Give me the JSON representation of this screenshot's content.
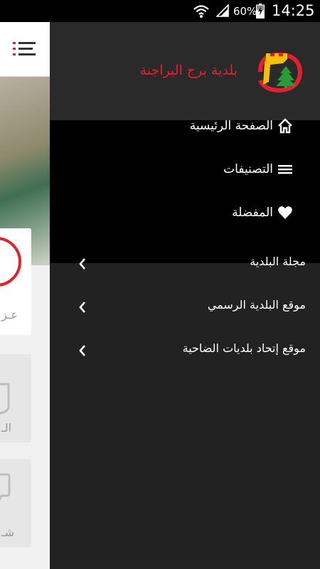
{
  "status_bar": {
    "battery_percent": "60%",
    "time": "14:25",
    "icons": [
      "wifi-icon",
      "signal-icon",
      "battery-charging-icon"
    ]
  },
  "background_page": {
    "card_text_1": "عـز",
    "card_text_2": "الـ",
    "card_text_3": "شـ"
  },
  "drawer": {
    "brand_name": "بلدية برج البراجنة",
    "primary_menu": [
      {
        "label": "الصفحة الرئيسية",
        "icon": "home-icon"
      },
      {
        "label": "التصنيفات",
        "icon": "list-icon"
      },
      {
        "label": "المفضلة",
        "icon": "heart-icon"
      }
    ],
    "links": [
      {
        "label": "مجلة البلدية",
        "icon": "chevron-left-icon"
      },
      {
        "label": "موقع البلدية الرسمي",
        "icon": "chevron-left-icon"
      },
      {
        "label": "موقع إتحاد بلديات الضاحية",
        "icon": "chevron-left-icon"
      }
    ]
  },
  "colors": {
    "accent_red": "#e5202e",
    "drawer_bg": "#222222",
    "header_bg": "#2a2a2a",
    "primary_menu_bg": "#000000",
    "logo_yellow": "#f2c200",
    "cedar_green": "#2a9a3a"
  }
}
